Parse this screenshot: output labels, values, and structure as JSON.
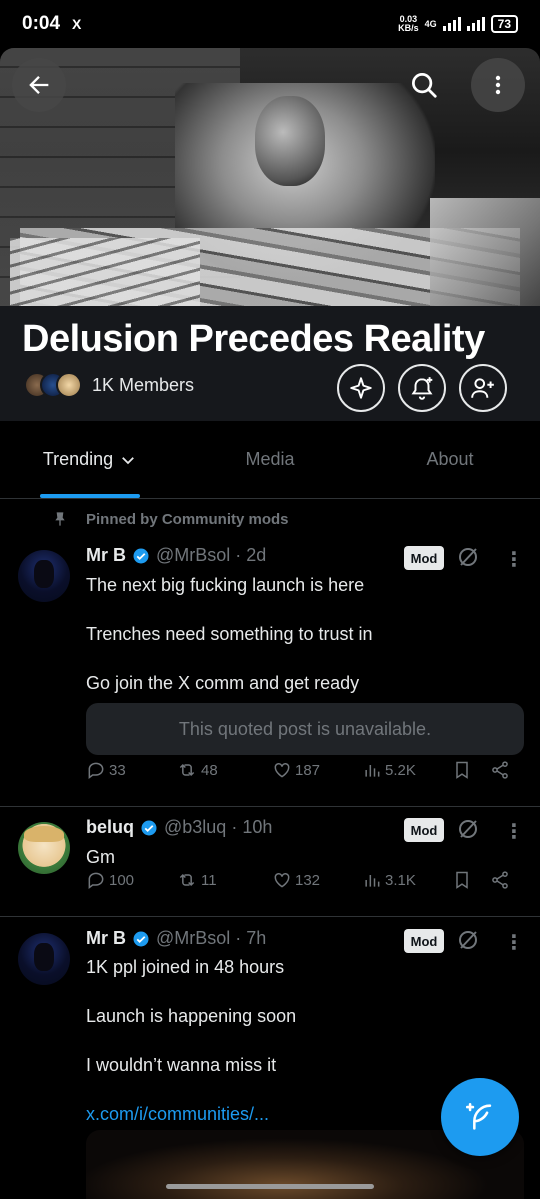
{
  "status_bar": {
    "time": "0:04",
    "app_indicator": "X",
    "net_speed_value": "0.03",
    "net_speed_unit": "KB/s",
    "network_type": "4G",
    "battery": "73"
  },
  "banner": {
    "icons": [
      "back-arrow-icon",
      "search-icon",
      "more-vertical-icon"
    ]
  },
  "community": {
    "title": "Delusion Precedes Reality",
    "members": "1K Members",
    "actions": [
      "sparkle-icon",
      "bell-add-icon",
      "person-add-icon"
    ]
  },
  "tabs": [
    {
      "label": "Trending",
      "active": true
    },
    {
      "label": "Media",
      "active": false
    },
    {
      "label": "About",
      "active": false
    }
  ],
  "pinned_label": "Pinned by Community mods",
  "posts": [
    {
      "name": "Mr B",
      "handle": "@MrBsol",
      "time": "· 2d",
      "badge": "Mod",
      "lines": [
        "The next big fucking launch is here",
        "Trenches need something to trust in",
        "Go join the X comm and get ready"
      ],
      "quoted": "This quoted post is unavailable.",
      "stats": {
        "replies": "33",
        "reposts": "48",
        "likes": "187",
        "views": "5.2K"
      }
    },
    {
      "name": "beluq",
      "handle": "@b3luq",
      "time": "· 10h",
      "badge": "Mod",
      "lines": [
        "Gm"
      ],
      "stats": {
        "replies": "100",
        "reposts": "11",
        "likes": "132",
        "views": "3.1K"
      }
    },
    {
      "name": "Mr B",
      "handle": "@MrBsol",
      "time": "· 7h",
      "badge": "Mod",
      "lines": [
        "1K ppl joined in 48 hours",
        "Launch is happening soon",
        "I wouldn’t wanna miss it"
      ],
      "link": "x.com/i/communities/..."
    }
  ],
  "colors": {
    "accent": "#1d9bf0",
    "background": "#000000",
    "muted": "#71767b",
    "text": "#e7e9ea"
  }
}
